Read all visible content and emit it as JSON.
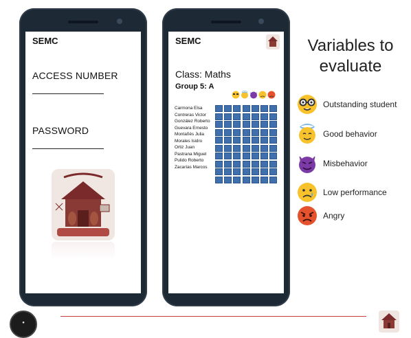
{
  "login_screen": {
    "title": "SEMC",
    "access_label": "ACCESS NUMBER",
    "password_label": "PASSWORD"
  },
  "class_screen": {
    "title": "SEMC",
    "class_label": "Class: Maths",
    "group_label": "Group 5: A",
    "students": [
      "Carmona Elsa",
      "Contreras Victor",
      "González Roberto",
      "Guevara Ernesto",
      "Montañés Julia",
      "Morales Isidro",
      "Ortiz Juan",
      "Pastrana Miguel",
      "Pulido Roberto",
      "Zacarías Marcos"
    ]
  },
  "legend": {
    "title": "Variables to evaluate",
    "items": [
      {
        "icon": "nerd-face-icon",
        "label": "Outstanding student"
      },
      {
        "icon": "halo-face-icon",
        "label": "Good behavior"
      },
      {
        "icon": "devil-face-icon",
        "label": "Misbehavior"
      },
      {
        "icon": "sad-face-icon",
        "label": "Low performance"
      },
      {
        "icon": "angry-face-icon",
        "label": "Angry"
      }
    ]
  },
  "colors": {
    "grid_cell": "#3f6fad",
    "accent_line": "#c33b3b",
    "phone_body": "#1d2a36"
  }
}
